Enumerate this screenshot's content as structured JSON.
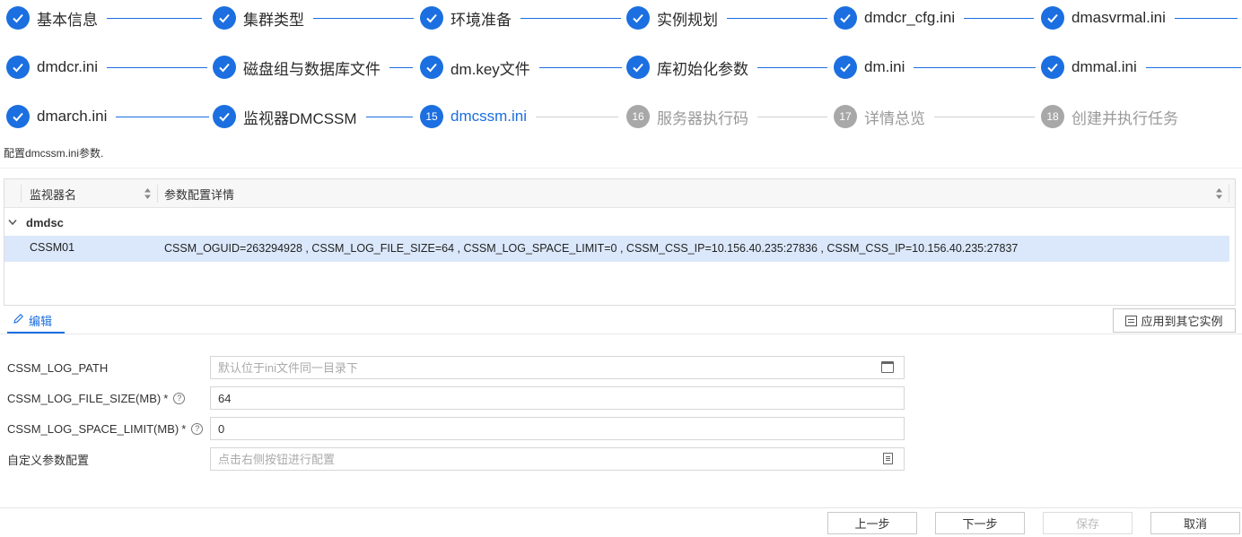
{
  "steps": [
    {
      "label": "基本信息",
      "status": "done"
    },
    {
      "label": "集群类型",
      "status": "done"
    },
    {
      "label": "环境准备",
      "status": "done"
    },
    {
      "label": "实例规划",
      "status": "done"
    },
    {
      "label": "dmdcr_cfg.ini",
      "status": "done"
    },
    {
      "label": "dmasvrmal.ini",
      "status": "done"
    },
    {
      "label": "dmdcr.ini",
      "status": "done"
    },
    {
      "label": "磁盘组与数据库文件",
      "status": "done"
    },
    {
      "label": "dm.key文件",
      "status": "done"
    },
    {
      "label": "库初始化参数",
      "status": "done"
    },
    {
      "label": "dm.ini",
      "status": "done"
    },
    {
      "label": "dmmal.ini",
      "status": "done"
    },
    {
      "label": "dmarch.ini",
      "status": "done"
    },
    {
      "label": "监视器DMCSSM",
      "status": "done"
    },
    {
      "number": "15",
      "label": "dmcssm.ini",
      "status": "active"
    },
    {
      "number": "16",
      "label": "服务器执行码",
      "status": "todo"
    },
    {
      "number": "17",
      "label": "详情总览",
      "status": "todo"
    },
    {
      "number": "18",
      "label": "创建并执行任务",
      "status": "todo"
    }
  ],
  "hint": "配置dmcssm.ini参数.",
  "table": {
    "columns": [
      "监视器名",
      "参数配置详情"
    ],
    "group": "dmdsc",
    "rows": [
      {
        "name": "CSSM01",
        "detail": "CSSM_OGUID=263294928 , CSSM_LOG_FILE_SIZE=64 , CSSM_LOG_SPACE_LIMIT=0 , CSSM_CSS_IP=10.156.40.235:27836 , CSSM_CSS_IP=10.156.40.235:27837"
      }
    ]
  },
  "edit_tab": "编辑",
  "apply_button": "应用到其它实例",
  "form": {
    "log_path": {
      "label": "CSSM_LOG_PATH",
      "value": "",
      "placeholder": "默认位于ini文件同一目录下"
    },
    "log_file_size": {
      "label": "CSSM_LOG_FILE_SIZE(MB)",
      "required": "*",
      "value": "64"
    },
    "log_space_limit": {
      "label": "CSSM_LOG_SPACE_LIMIT(MB)",
      "required": "*",
      "value": "0"
    },
    "custom": {
      "label": "自定义参数配置",
      "value": "",
      "placeholder": "点击右侧按钮进行配置"
    }
  },
  "footer": {
    "prev": "上一步",
    "next": "下一步",
    "save": "保存",
    "cancel": "取消"
  }
}
